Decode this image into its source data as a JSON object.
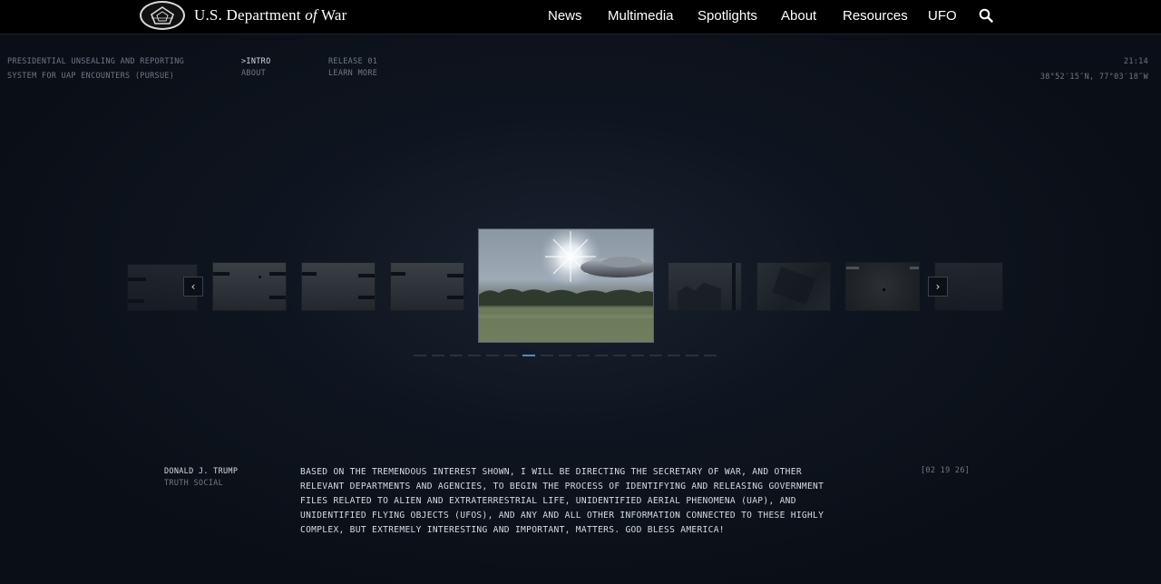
{
  "header": {
    "brand_pre": "U.S. Department",
    "brand_of": "of",
    "brand_post": "War",
    "nav": [
      "News",
      "Multimedia",
      "Spotlights",
      "About",
      "Resources",
      "UFO"
    ]
  },
  "subheader": {
    "program_line1": "PRESIDENTIAL UNSEALING AND REPORTING",
    "program_line2": "SYSTEM FOR UAP ENCOUNTERS (PURSUE)",
    "intro": ">INTRO",
    "about": "ABOUT",
    "release": "RELEASE 01",
    "learn_more": "LEARN MORE",
    "time": "21:14",
    "coords": "38°52′15″N, 77°03′18″W"
  },
  "carousel": {
    "prev_label": "‹",
    "next_label": "›",
    "slide_count": 17,
    "active_index": 6
  },
  "quote": {
    "author": "DONALD J. TRUMP",
    "source": "TRUTH SOCIAL",
    "lines": [
      "BASED ON THE TREMENDOUS INTEREST SHOWN, I WILL BE DIRECTING THE SECRETARY OF WAR, AND OTHER",
      "RELEVANT DEPARTMENTS AND AGENCIES, TO BEGIN THE PROCESS OF IDENTIFYING AND RELEASING GOVERNMENT",
      "FILES RELATED TO ALIEN AND EXTRATERRESTRIAL LIFE, UNIDENTIFIED AERIAL PHENOMENA (UAP), AND",
      "UNIDENTIFIED FLYING OBJECTS (UFOS), AND ANY AND ALL OTHER INFORMATION CONNECTED TO THESE HIGHLY",
      "COMPLEX, BUT EXTREMELY INTERESTING AND IMPORTANT, MATTERS. GOD BLESS AMERICA!"
    ],
    "date": "[02 19 26]"
  },
  "colors": {
    "accent": "#4f8dc6",
    "background": "#0a0e16"
  }
}
